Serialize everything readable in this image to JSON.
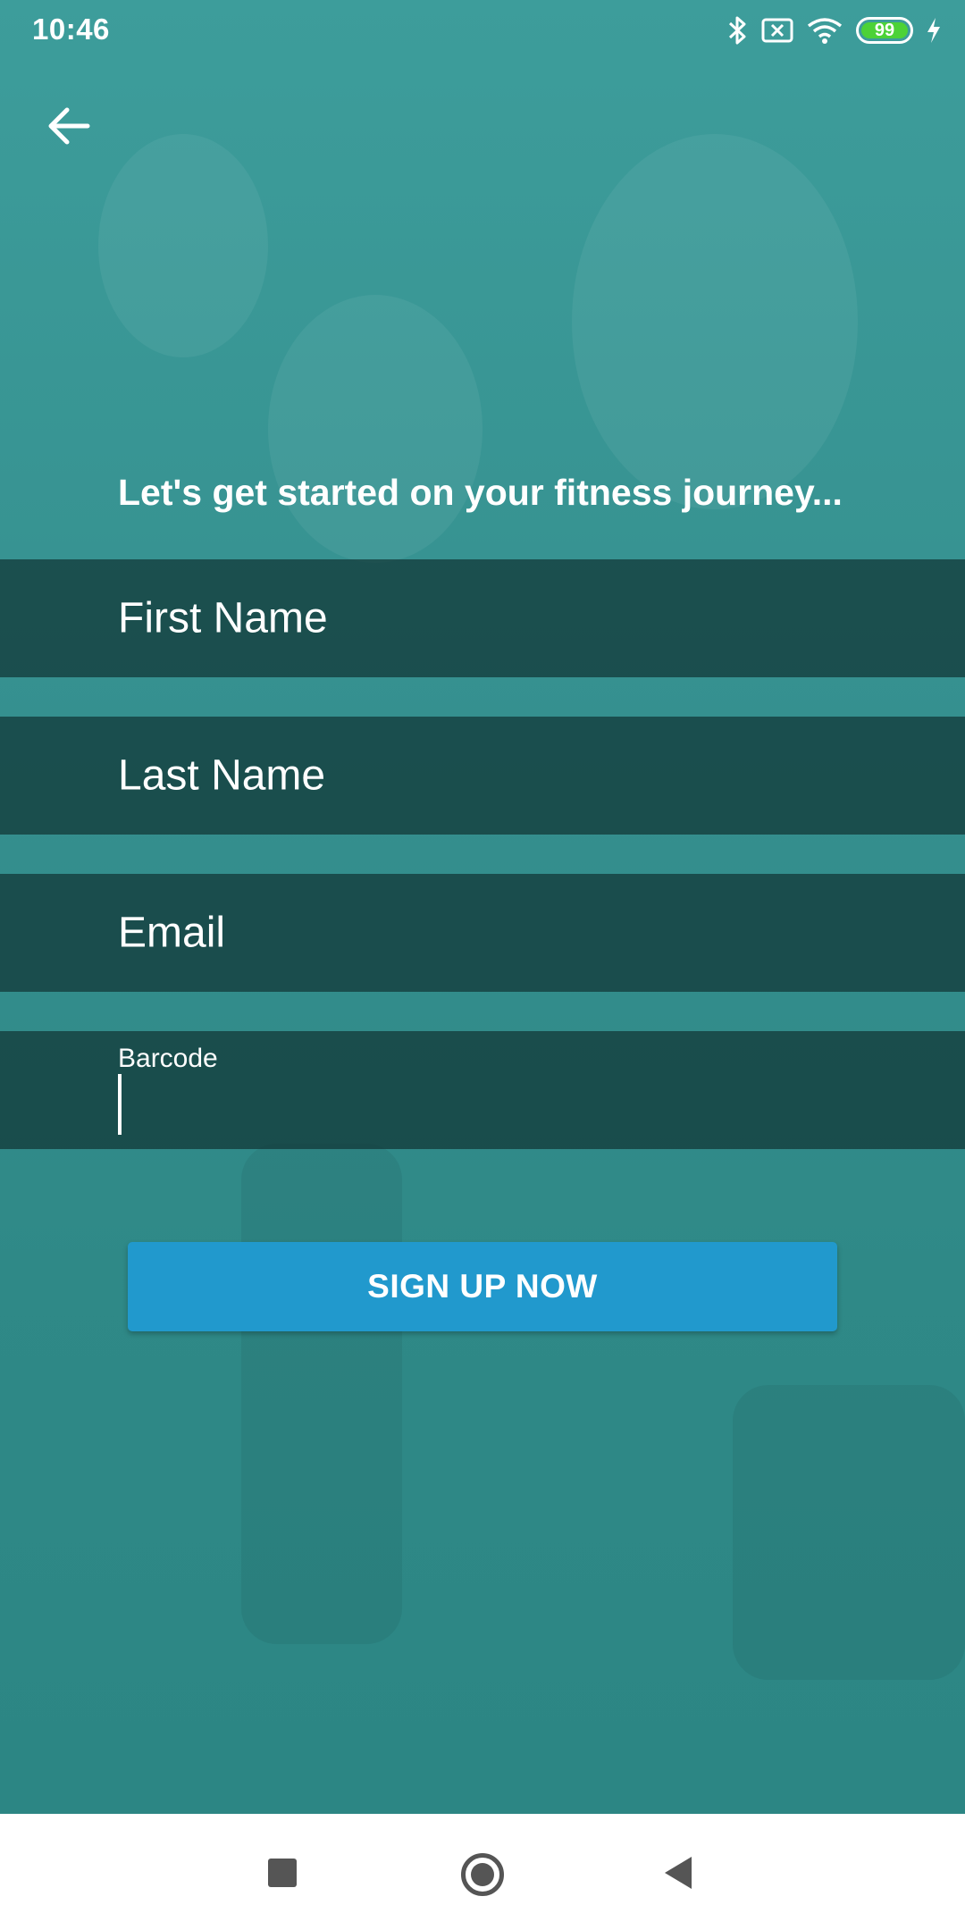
{
  "status_bar": {
    "time": "10:46",
    "battery_level": "99",
    "icons": [
      "bluetooth-icon",
      "no-sim-icon",
      "wifi-icon",
      "battery-icon",
      "charging-icon"
    ]
  },
  "header": {
    "back_icon": "arrow-left-icon"
  },
  "form": {
    "headline": "Let's get started on your fitness journey...",
    "first_name_placeholder": "First Name",
    "last_name_placeholder": "Last Name",
    "email_placeholder": "Email",
    "barcode_label": "Barcode",
    "barcode_value": ""
  },
  "actions": {
    "signup_label": "SIGN UP NOW"
  },
  "nav_bar": {
    "icons": [
      "recent-apps-icon",
      "home-icon",
      "back-icon"
    ]
  },
  "colors": {
    "background_teal": "#3a9593",
    "field_overlay": "#113534",
    "button_blue": "#2199cd",
    "battery_green": "#4cd237"
  }
}
